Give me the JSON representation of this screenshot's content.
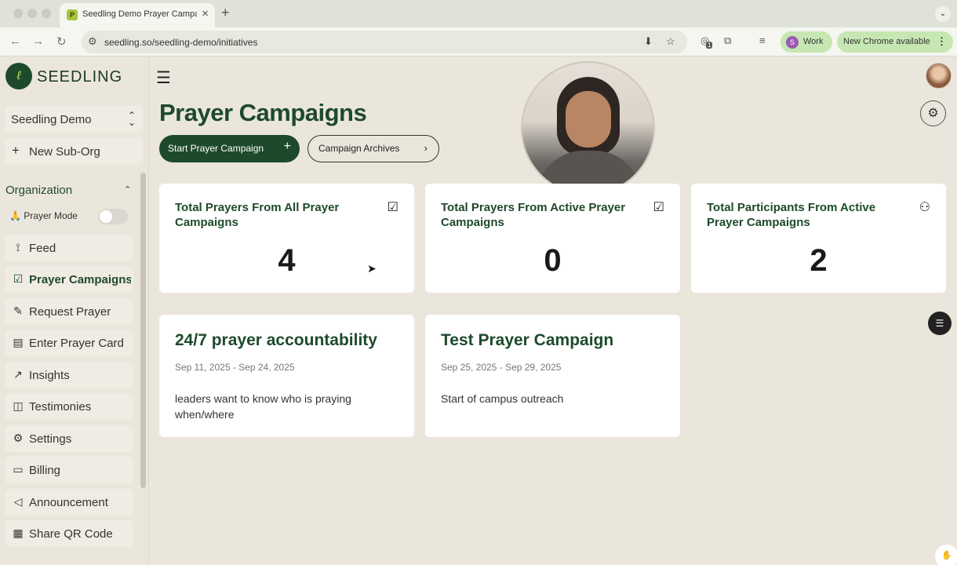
{
  "browser": {
    "tab_title": "Seedling Demo Prayer Campaigns",
    "tab_favicon_letter": "P",
    "url": "seedling.so/seedling-demo/initiatives",
    "extension_badge": "1",
    "profile_initial": "S",
    "profile_label": "Work",
    "update_label": "New Chrome available"
  },
  "sidebar": {
    "brand": "SEEDLING",
    "org_name": "Seedling Demo",
    "sub_org_label": "New Sub-Org",
    "section_title": "Organization",
    "prayer_mode_label": "🙏 Prayer Mode",
    "prayer_mode_on": false,
    "items": [
      {
        "label": "Feed",
        "icon": "rss-icon"
      },
      {
        "label": "Prayer Campaigns",
        "icon": "calendar-check-icon",
        "active": true
      },
      {
        "label": "Request Prayer",
        "icon": "notebook-icon"
      },
      {
        "label": "Enter Prayer Card",
        "icon": "document-icon"
      },
      {
        "label": "Insights",
        "icon": "line-chart-icon"
      },
      {
        "label": "Testimonies",
        "icon": "book-open-icon"
      },
      {
        "label": "Settings",
        "icon": "gear-icon"
      },
      {
        "label": "Billing",
        "icon": "credit-card-icon"
      },
      {
        "label": "Announcement",
        "icon": "megaphone-icon"
      },
      {
        "label": "Share QR Code",
        "icon": "qr-code-icon"
      }
    ]
  },
  "main": {
    "title": "Prayer Campaigns",
    "start_button": "Start Prayer Campaign",
    "archives_button": "Campaign Archives",
    "stats": [
      {
        "title": "Total Prayers From All Prayer Campaigns",
        "value": "4",
        "icon": "calendar-check-icon"
      },
      {
        "title": "Total Prayers From Active Prayer Campaigns",
        "value": "0",
        "icon": "calendar-check-icon"
      },
      {
        "title": "Total Participants From Active Prayer Campaigns",
        "value": "2",
        "icon": "users-icon"
      }
    ],
    "campaigns": [
      {
        "title": "24/7 prayer accountability",
        "dates": "Sep 11, 2025 - Sep 24, 2025",
        "description": "leaders want to know who is praying when/where"
      },
      {
        "title": "Test Prayer Campaign",
        "dates": "Sep 25, 2025 - Sep 29, 2025",
        "description": "Start of campus outreach"
      }
    ]
  },
  "colors": {
    "brand_green": "#1e4a2c",
    "page_background": "#ebe6dc",
    "card_background": "#ffffff",
    "chrome_chip": "#c6e7b2"
  }
}
